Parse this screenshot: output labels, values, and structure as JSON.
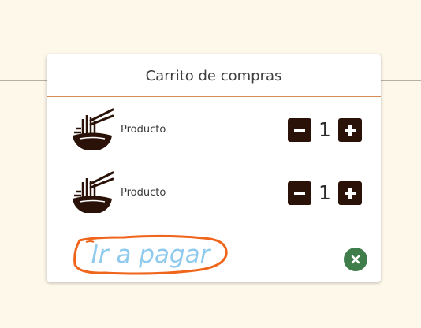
{
  "cart": {
    "title": "Carrito de compras",
    "items": [
      {
        "label": "Producto",
        "quantity": "1",
        "icon": "noodle-bowl-icon"
      },
      {
        "label": "Producto",
        "quantity": "1",
        "icon": "noodle-bowl-icon"
      }
    ],
    "pay_label": "Ir a pagar",
    "close_icon": "close-icon"
  },
  "colors": {
    "background": "#fdf8ea",
    "icon_dark": "#2a1208",
    "header_rule": "#d98b55",
    "pay_text": "#8ec9ee",
    "pay_outline": "#f0651c",
    "close_green": "#3f7e4b"
  }
}
